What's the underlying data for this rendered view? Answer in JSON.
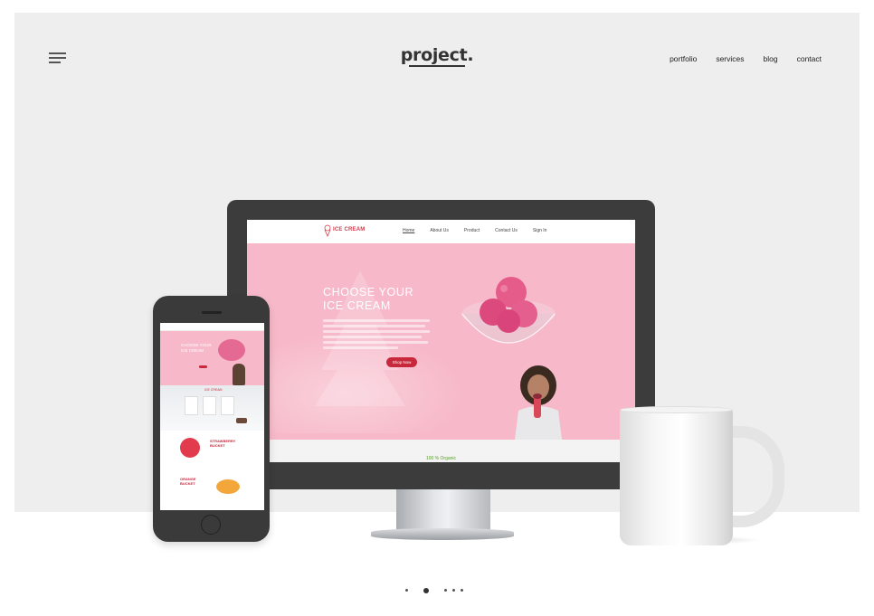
{
  "header": {
    "menu_icon": "hamburger-menu-icon",
    "logo": "project.",
    "nav": [
      "portfolio",
      "services",
      "blog",
      "contact"
    ]
  },
  "monitor_site": {
    "brand": "ICE CREAM",
    "nav": [
      "Home",
      "About Us",
      "Product",
      "Contact Us",
      "Sign In"
    ],
    "active_nav": "Home",
    "hero_title_line1": "CHOOSE YOUR",
    "hero_title_line2": "ICE CREAM",
    "cta": "Shop Now",
    "strip_text": "100 % Organic",
    "accent": "#c8283b",
    "hero_bg": "#f7b9c9"
  },
  "phone_site": {
    "hero_title_line1": "CHOOSE YOUR",
    "hero_title_line2": "ICE CREAM",
    "section_title": "ICE CREAM",
    "block1_line1": "STRAWBERRY",
    "block1_line2": "BUCKET",
    "block2_line1": "ORANGE",
    "block2_line2": "BUCKET"
  },
  "pagination": {
    "count": 5,
    "active_index": 1
  }
}
